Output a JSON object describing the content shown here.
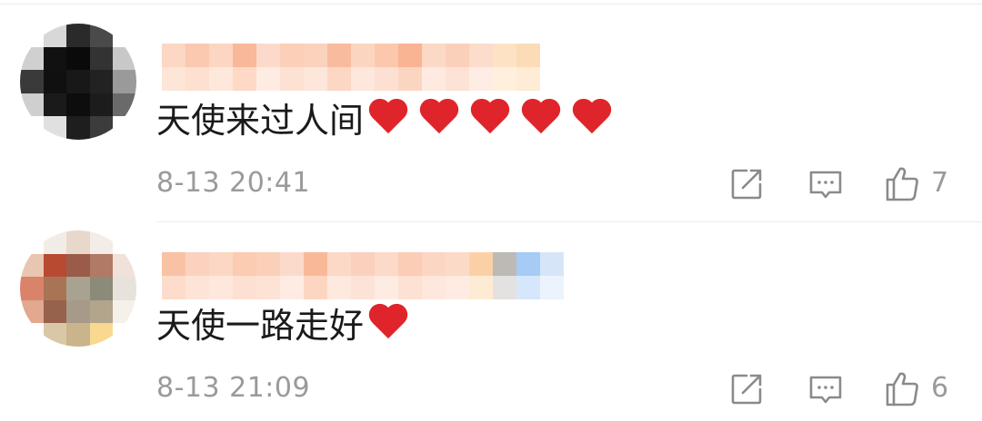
{
  "colors": {
    "heart": "#e0242b",
    "meta_text": "#9a9a9a",
    "icon": "#8a8a8a",
    "divider": "#ececec"
  },
  "comments": [
    {
      "text": "天使来过人间",
      "hearts": 5,
      "timestamp": "8-13 20:41",
      "likes": "7",
      "avatar_pixels": [
        [
          "#ffffff",
          "#d8d8d8",
          "#2a2a2a",
          "#4a4a4a",
          "#ffffff"
        ],
        [
          "#d0d0d0",
          "#111111",
          "#0a0a0a",
          "#333333",
          "#c8c8c8"
        ],
        [
          "#3a3a3a",
          "#101010",
          "#181818",
          "#222222",
          "#9a9a9a"
        ],
        [
          "#cfcfcf",
          "#1a1a1a",
          "#0d0d0d",
          "#1c1c1c",
          "#6a6a6a"
        ],
        [
          "#ffffff",
          "#e0e0e0",
          "#1e1e1e",
          "#3c3c3c",
          "#ffffff"
        ]
      ],
      "username_pixels": [
        [
          "#fbd7c4",
          "#fde5d8"
        ],
        [
          "#fbc9b0",
          "#fde0d0"
        ],
        [
          "#fcd6c2",
          "#fee8dc"
        ],
        [
          "#f9b899",
          "#fdd9c6"
        ],
        [
          "#fcdacb",
          "#feece2"
        ],
        [
          "#fbcfb8",
          "#fde2d4"
        ],
        [
          "#fbd2bc",
          "#fde6da"
        ],
        [
          "#f9bb9e",
          "#fcd7c3"
        ],
        [
          "#fcd5c0",
          "#fee7dc"
        ],
        [
          "#fbc8ae",
          "#fde0d1"
        ],
        [
          "#f9b494",
          "#fcd5c1"
        ],
        [
          "#fcd9c7",
          "#feeae0"
        ],
        [
          "#fbd0ba",
          "#fde3d5"
        ],
        [
          "#fcdccb",
          "#feede4"
        ],
        [
          "#fde3c4",
          "#fff0dd"
        ],
        [
          "#fcdcb6",
          "#feecd6"
        ]
      ]
    },
    {
      "text": "天使一路走好",
      "hearts": 1,
      "timestamp": "8-13 21:09",
      "likes": "6",
      "avatar_pixels": [
        [
          "#ffffff",
          "#f2ece6",
          "#e8d8cc",
          "#f4ece6",
          "#ffffff"
        ],
        [
          "#e9c6b0",
          "#b84a32",
          "#9a5c48",
          "#b07a66",
          "#f0e2d8"
        ],
        [
          "#d9836a",
          "#a97455",
          "#a8a290",
          "#8c8a78",
          "#e8e2dc"
        ],
        [
          "#e2a890",
          "#96624c",
          "#a89a88",
          "#b3a48c",
          "#f6f0ea"
        ],
        [
          "#ffffff",
          "#d9c8a8",
          "#c9b48c",
          "#f9d890",
          "#ffffff"
        ]
      ],
      "username_pixels": [
        [
          "#f9c2a4",
          "#fddccb"
        ],
        [
          "#fbd2bd",
          "#fee4d6"
        ],
        [
          "#fcd7c4",
          "#fee8dd"
        ],
        [
          "#fbcbb2",
          "#fde0d2"
        ],
        [
          "#fad0b9",
          "#fde3d6"
        ],
        [
          "#fcdacb",
          "#feece3"
        ],
        [
          "#f9b999",
          "#fdd6c2"
        ],
        [
          "#fcd8c6",
          "#fee9df"
        ],
        [
          "#fbd0bc",
          "#fde3d7"
        ],
        [
          "#fcd9c9",
          "#feebe2"
        ],
        [
          "#fbcdb6",
          "#fde1d3"
        ],
        [
          "#fcd6c2",
          "#fee8dd"
        ],
        [
          "#fcdac8",
          "#feebe1"
        ],
        [
          "#fcd0a6",
          "#feebd4"
        ],
        [
          "#bdbab6",
          "#e4e2e0"
        ],
        [
          "#a6cbf4",
          "#d6e7fb"
        ],
        [
          "#d6e6f8",
          "#ecf3fc"
        ]
      ]
    }
  ]
}
